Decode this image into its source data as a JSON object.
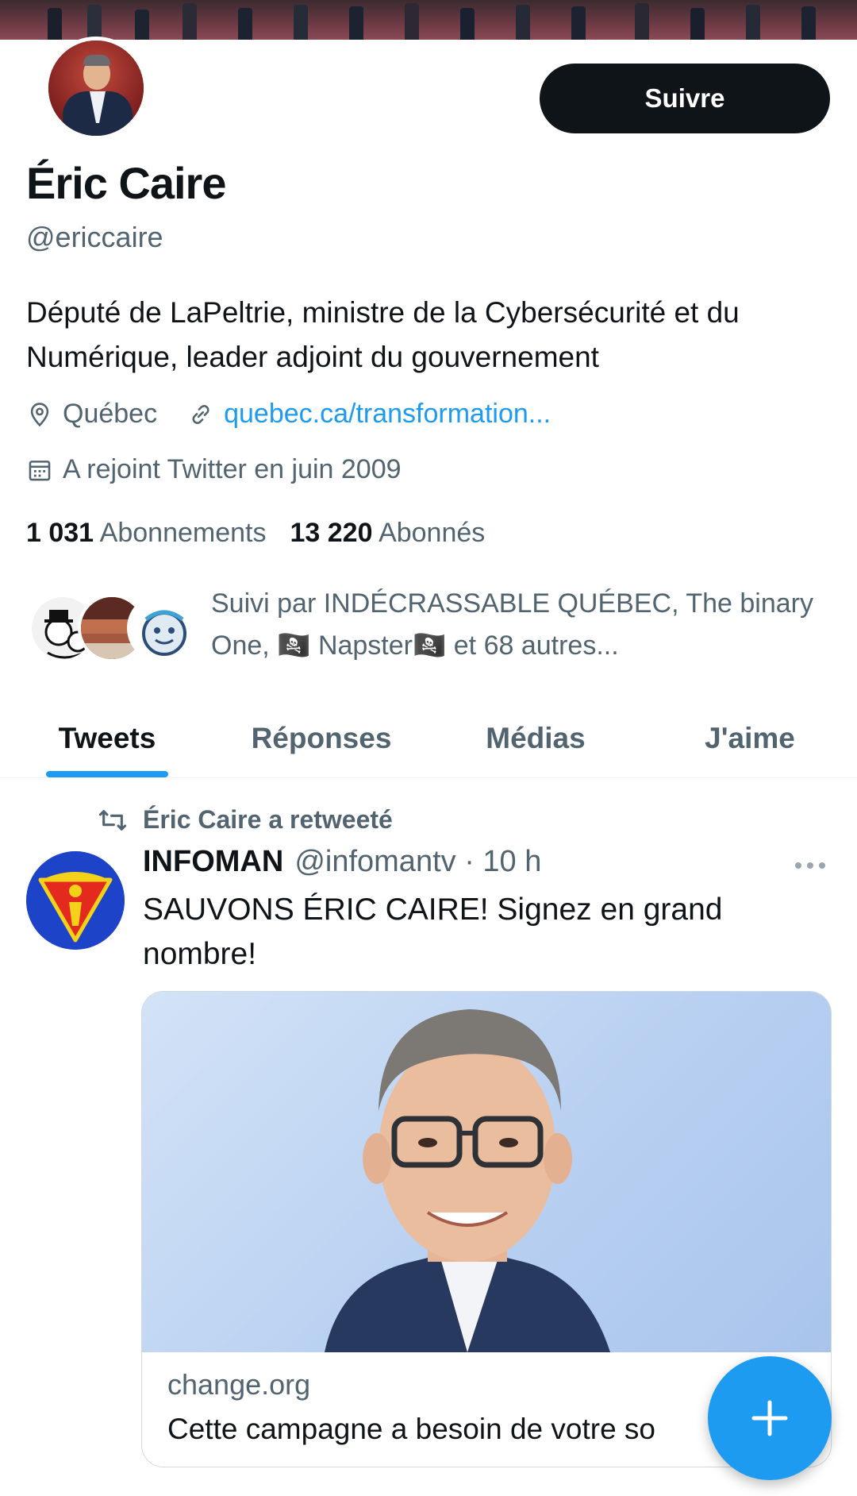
{
  "profile": {
    "follow_label": "Suivre",
    "display_name": "Éric Caire",
    "handle": "@ericcaire",
    "bio": "Député de LaPeltrie, ministre de la Cybersécurité et du Numérique, leader adjoint du gouvernement",
    "location": "Québec",
    "website": "quebec.ca/transformation...",
    "joined": "A rejoint Twitter en juin 2009",
    "following_count": "1 031",
    "following_label": "Abonnements",
    "followers_count": "13 220",
    "followers_label": "Abonnés",
    "followed_by": "Suivi par INDÉCRASSABLE QUÉBEC, The binary One, 🏴‍☠️ Napster🏴‍☠️ et 68 autres..."
  },
  "tabs": [
    {
      "label": "Tweets",
      "active": true
    },
    {
      "label": "Réponses",
      "active": false
    },
    {
      "label": "Médias",
      "active": false
    },
    {
      "label": "J'aime",
      "active": false
    }
  ],
  "tweet": {
    "retweet_note": "Éric Caire a retweeté",
    "author_name": "INFOMAN",
    "author_handle_time": "@infomantv · 10 h",
    "text": "SAUVONS ÉRIC CAIRE! Signez en grand nombre!",
    "card": {
      "domain": "change.org",
      "title": "Cette campagne a besoin de votre so"
    }
  },
  "icons": {
    "location": "location-pin-icon",
    "link": "link-icon",
    "calendar": "calendar-icon",
    "retweet": "retweet-icon",
    "more": "more-horizontal-icon",
    "compose": "plus-icon"
  },
  "colors": {
    "accent": "#1d9bf0",
    "text_primary": "#0f1419",
    "text_secondary": "#536471",
    "follow_button": "#0f1419"
  }
}
